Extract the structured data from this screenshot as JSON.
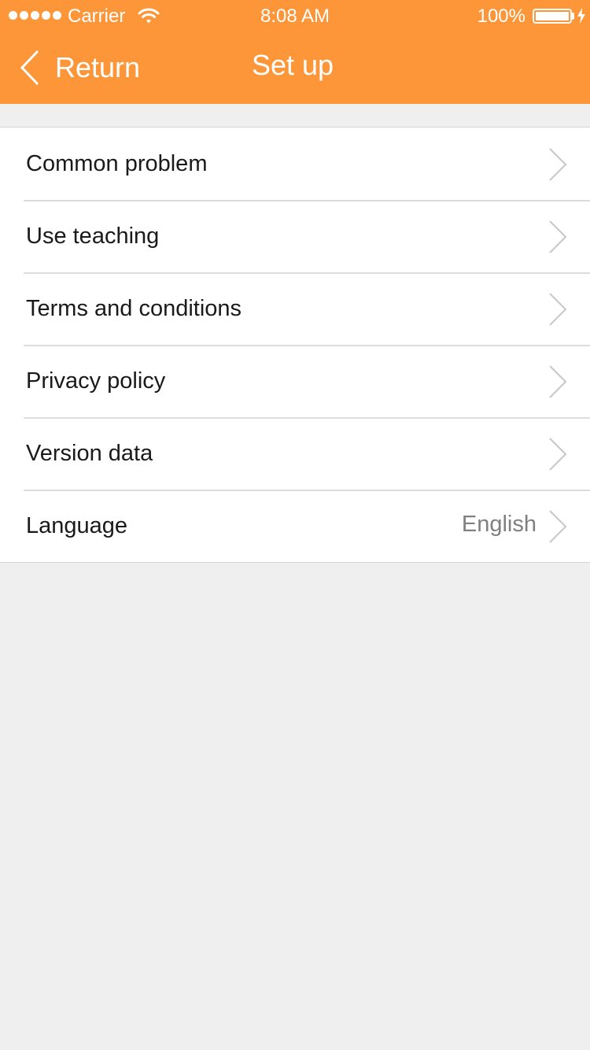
{
  "status_bar": {
    "carrier": "Carrier",
    "time": "8:08 AM",
    "battery": "100%",
    "signal_icon": "signal-dots-icon",
    "wifi_icon": "wifi-icon",
    "battery_icon": "battery-icon",
    "charging_icon": "charging-bolt-icon"
  },
  "nav": {
    "back_label": "Return",
    "back_icon": "chevron-left-icon",
    "title": "Set up"
  },
  "settings": {
    "items": [
      {
        "label": "Common problem",
        "value": ""
      },
      {
        "label": "Use teaching",
        "value": ""
      },
      {
        "label": "Terms and conditions",
        "value": ""
      },
      {
        "label": "Privacy policy",
        "value": ""
      },
      {
        "label": "Version data",
        "value": ""
      },
      {
        "label": "Language",
        "value": "English"
      }
    ],
    "row_icon": "chevron-right-icon"
  },
  "colors": {
    "header_background": "#fd9638",
    "page_background": "#efefef",
    "row_background": "#ffffff",
    "label_text": "#1a1a1a",
    "value_text": "#808080",
    "chevron": "#c7c7cc"
  }
}
